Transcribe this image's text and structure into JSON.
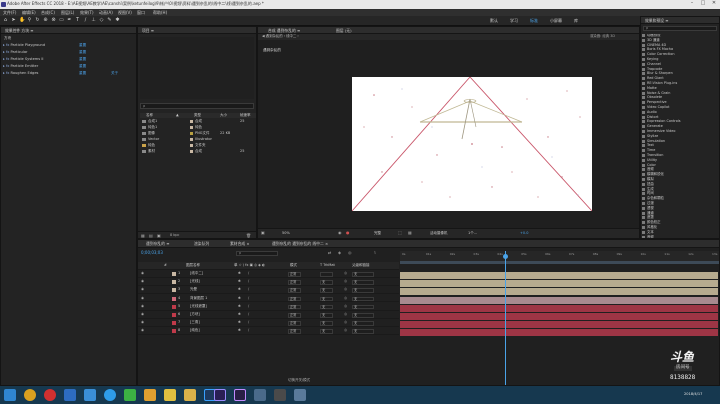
{
  "window": {
    "title": "Adobe After Effects CC 2018 - E:\\AE视频\\AE教学\\AE\\canshi\\案例\\ketunfeilog\\9\\帐户\\0\\视频\\资料\\遇到杂乱的\\线中二\\线\\遇到杂乱的.aep *",
    "controls": [
      "–",
      "□",
      "✕"
    ]
  },
  "menu": [
    "文件(F)",
    "编辑(E)",
    "合成(C)",
    "图层(L)",
    "效果(T)",
    "动画(A)",
    "视图(V)",
    "窗口",
    "帮助(H)"
  ],
  "workspaces": [
    "默认",
    "学习",
    "标准",
    "小屏幕",
    "库"
  ],
  "effect_controls": {
    "tab": "效果控件 方块 ≡",
    "layer": "方块",
    "effects": [
      {
        "name": "Particle Playground",
        "value": "重置"
      },
      {
        "name": "Particular",
        "value": "重置"
      },
      {
        "name": "Particle Systems II",
        "value": "重置"
      },
      {
        "name": "Particle Emitter",
        "value": "重置"
      },
      {
        "name": "Roughen Edges",
        "value": "重置",
        "extra": "关于"
      }
    ]
  },
  "project": {
    "tab": "项目 ≡",
    "search_placeholder": "ρ",
    "columns": [
      "名称",
      "▲",
      "类型",
      "大小",
      "帧速率"
    ],
    "rows": [
      {
        "name": "合成1",
        "type": "合成",
        "size": "",
        "fps": "25",
        "color": "#c9b8a4"
      },
      {
        "name": "纯色1",
        "type": "纯色",
        "size": "",
        "fps": "",
        "color": "#c9b8a4"
      },
      {
        "name": "图像",
        "type": "PNG文件",
        "size": "22 KB",
        "fps": "",
        "color": "#b8a040"
      },
      {
        "name": "Vector",
        "type": "Illustrator",
        "size": "",
        "fps": "",
        "color": "#c9b8a4"
      },
      {
        "name": "纯色",
        "type": "文件夹",
        "size": "",
        "fps": "",
        "color": "#c9b8a4"
      },
      {
        "name": "素材",
        "type": "合成",
        "size": "",
        "fps": "25",
        "color": "#c9b8a4"
      }
    ],
    "footer": "8 bpc"
  },
  "composition": {
    "tab": "合成 遇到杂乱的 ≡",
    "secondary_tab": "图层 (无)",
    "breadcrumb": "遇到杂乱的",
    "right_label": "渲染器: 经典 3D",
    "path": "◀ 遇到杂乱的 ‹ 线中二 ›",
    "zoom": "50%",
    "quality": "完整",
    "camera": "活动摄像机",
    "views": "1个...",
    "offset": "+0.0"
  },
  "effects_panel": {
    "tab": "效果和预设 ≡",
    "search_placeholder": "ρ",
    "items": [
      "动画预设",
      "3D 通道",
      "CINEMA 4D",
      "Boris FX Mocha",
      "Color Correction",
      "Keying",
      "Channel",
      "Trapcode",
      "Blur & Sharpen",
      "Red Giant",
      "RE:Vision Plug-ins",
      "Matte",
      "Noise & Grain",
      "Obsolete",
      "Perspective",
      "Video Copilot",
      "Audio",
      "Distort",
      "Expression Controls",
      "Generate",
      "Immersive Video",
      "Stylize",
      "Simulation",
      "Text",
      "Time",
      "Transition",
      "Utility",
      "Color",
      "音频",
      "模糊和锐化",
      "模拟",
      "扭曲",
      "生成",
      "时间",
      "杂色和颗粒",
      "过渡",
      "透视",
      "通道",
      "遮罩",
      "颜色校正",
      "风格化",
      "文本",
      "音频"
    ]
  },
  "timeline": {
    "tabs": [
      "遇到杂乱的 ≡",
      "渲染队列",
      "素材合成 ×",
      "遇到杂乱的 遇到杂乱的 线中二 ×"
    ],
    "timecode": "0;00;03;03",
    "search_placeholder": "ρ",
    "columns": [
      "#",
      "图层名称",
      "单 ☆ \\ fx ▣ ◎ ◈ ◐",
      "模式",
      "T TrkMat",
      "父级和链接"
    ],
    "layers": [
      {
        "num": "1",
        "name": "[线中二]",
        "mode": "正常",
        "trk": "",
        "parent": "无",
        "color": "#c9b8a4"
      },
      {
        "num": "2",
        "name": "[光线]",
        "mode": "正常",
        "trk": "无",
        "parent": "无",
        "color": "#c9b8a4"
      },
      {
        "num": "3",
        "name": "光晕",
        "mode": "正常",
        "trk": "无",
        "parent": "无",
        "color": "#c9b8a4"
      },
      {
        "num": "4",
        "name": "背景图层 1",
        "mode": "正常",
        "trk": "无",
        "parent": "无",
        "color": "#d06a7a"
      },
      {
        "num": "5",
        "name": "[光线遮罩]",
        "mode": "正常",
        "trk": "无",
        "parent": "无",
        "color": "#c03a4a"
      },
      {
        "num": "6",
        "name": "[方块]",
        "mode": "正常",
        "trk": "无",
        "parent": "无",
        "color": "#c03a4a"
      },
      {
        "num": "7",
        "name": "[三角]",
        "mode": "正常",
        "trk": "无",
        "parent": "无",
        "color": "#c03a4a"
      },
      {
        "num": "8",
        "name": "[纯色]",
        "mode": "正常",
        "trk": "无",
        "parent": "无",
        "color": "#c03a4a"
      }
    ],
    "ruler": [
      "0s",
      "01s",
      "02s",
      "03s",
      "04s",
      "05s",
      "06s",
      "07s",
      "08s",
      "09s",
      "10s",
      "11s",
      "12s",
      "13s"
    ],
    "bars": [
      {
        "color": "#b7ab8f"
      },
      {
        "color": "#b7ab8f"
      },
      {
        "color": "#b7ab8f"
      },
      {
        "color": "#a88a8f"
      },
      {
        "color": "#9e3545"
      },
      {
        "color": "#9e3545"
      },
      {
        "color": "#9e3545"
      },
      {
        "color": "#9e3545"
      }
    ],
    "footer": "切换开关/模式"
  },
  "watermark": {
    "logo": "斗鱼",
    "sub": "房间号",
    "id": "8138828"
  },
  "taskbar": {
    "icons": [
      "windows-start",
      "ie",
      "netease-music",
      "folder",
      "media",
      "qq",
      "wechat",
      "app",
      "app2",
      "folder2",
      "photoshop",
      "after-effects",
      "premiere",
      "app3",
      "app4",
      "app5"
    ],
    "clock": "2018/4/17"
  },
  "colors": {
    "accent": "#4aa3e8",
    "pink_line": "#c9566a",
    "layer_red": "#9e3545",
    "layer_tan": "#b7ab8f"
  }
}
